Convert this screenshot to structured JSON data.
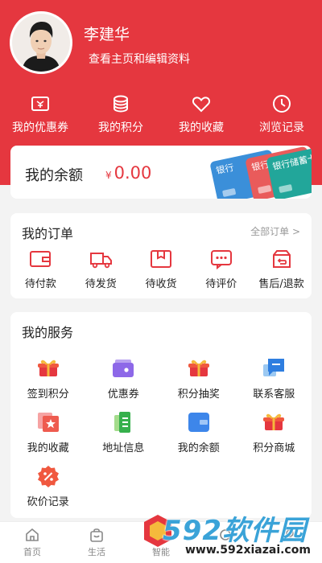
{
  "profile": {
    "name": "李建华",
    "subtitle": "查看主页和编辑资料"
  },
  "quick_links": [
    {
      "label": "我的优惠券",
      "icon": "ticket-icon"
    },
    {
      "label": "我的积分",
      "icon": "coins-icon"
    },
    {
      "label": "我的收藏",
      "icon": "heart-icon"
    },
    {
      "label": "浏览记录",
      "icon": "clock-icon"
    }
  ],
  "balance": {
    "label": "我的余额",
    "currency": "¥",
    "amount": "0.00",
    "card_texts": [
      "银行",
      "银行",
      "银行储蓄卡"
    ]
  },
  "orders": {
    "title": "我的订单",
    "all_label": "全部订单 >",
    "items": [
      {
        "label": "待付款",
        "icon": "wallet-icon"
      },
      {
        "label": "待发货",
        "icon": "truck-icon"
      },
      {
        "label": "待收货",
        "icon": "box-icon"
      },
      {
        "label": "待评价",
        "icon": "comment-icon"
      },
      {
        "label": "售后/退款",
        "icon": "refund-icon"
      }
    ]
  },
  "services": {
    "title": "我的服务",
    "items": [
      {
        "label": "签到积分",
        "icon": "gift-box-icon"
      },
      {
        "label": "优惠券",
        "icon": "coupon-wallet-icon"
      },
      {
        "label": "积分抽奖",
        "icon": "gift-box-icon"
      },
      {
        "label": "联系客服",
        "icon": "chat-icon"
      },
      {
        "label": "我的收藏",
        "icon": "star-card-icon"
      },
      {
        "label": "地址信息",
        "icon": "document-icon"
      },
      {
        "label": "我的余额",
        "icon": "wallet-card-icon"
      },
      {
        "label": "积分商城",
        "icon": "gift-box-icon"
      },
      {
        "label": "砍价记录",
        "icon": "discount-icon"
      }
    ]
  },
  "tabbar": [
    {
      "label": "首页",
      "icon": "home-icon"
    },
    {
      "label": "生活",
      "icon": "bag-icon"
    },
    {
      "label": "智能",
      "icon": "smart-icon"
    },
    {
      "label": "",
      "icon": "tab-icon"
    },
    {
      "label": "",
      "icon": "tab-icon"
    }
  ],
  "watermark": {
    "brand": "592软件园",
    "url": "www.592xiazai.com"
  },
  "colors": {
    "brand_red": "#e5373f",
    "watermark_blue": "#3aa3d8"
  }
}
